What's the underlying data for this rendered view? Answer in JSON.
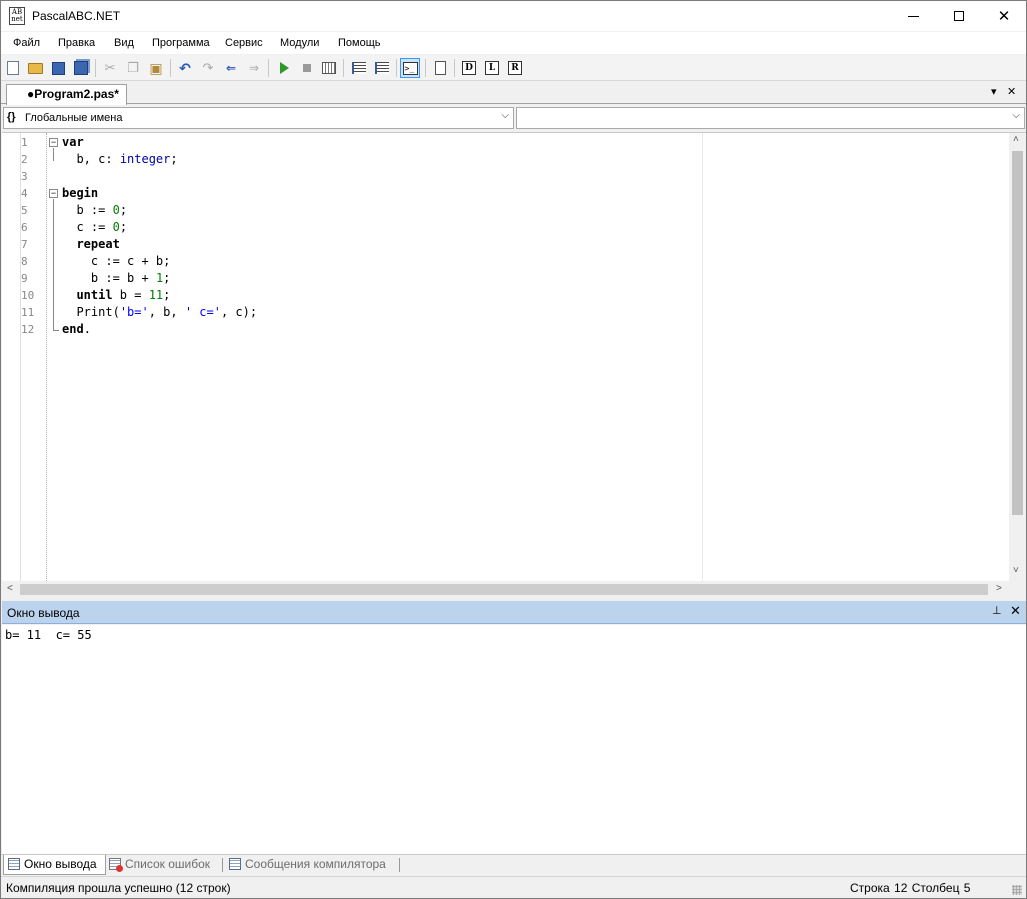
{
  "window": {
    "title": "PascalABC.NET",
    "icon_text": "AB\nnet",
    "minimize_icon": "minimize-icon",
    "maximize_icon": "maximize-icon",
    "close_icon": "close-icon"
  },
  "menu": [
    "Файл",
    "Правка",
    "Вид",
    "Программа",
    "Сервис",
    "Модули",
    "Помощь"
  ],
  "toolbar": {
    "buttons": [
      "new-file",
      "open",
      "save",
      "save-all",
      "cut",
      "copy",
      "paste",
      "undo",
      "redo",
      "find",
      "find-next",
      "run",
      "stop",
      "compile",
      "add-watch",
      "debug-step",
      "console-output",
      "page",
      "d-tool",
      "l-tool",
      "r-tool"
    ],
    "console_glyph": ">_",
    "d_glyph": "D",
    "l_glyph": "L",
    "r_glyph": "R"
  },
  "document_tab": {
    "label": "●Program2.pas*",
    "dropdown_glyph": "▾",
    "close_glyph": "✕"
  },
  "navigation": {
    "left_combo_icon": "{}",
    "left_combo_value": "Глобальные имена",
    "right_combo_value": "",
    "arrow_glyph": "⌵"
  },
  "editor": {
    "line_numbers": [
      "1",
      "2",
      "3",
      "4",
      "5",
      "6",
      "7",
      "8",
      "9",
      "10",
      "11",
      "12"
    ],
    "code_lines": [
      {
        "indent": "",
        "tokens": [
          {
            "t": "var",
            "c": "kw"
          }
        ]
      },
      {
        "indent": "  ",
        "tokens": [
          {
            "t": "b, c: ",
            "c": ""
          },
          {
            "t": "integer",
            "c": "ty"
          },
          {
            "t": ";",
            "c": ""
          }
        ]
      },
      {
        "indent": "",
        "tokens": []
      },
      {
        "indent": "",
        "tokens": [
          {
            "t": "begin",
            "c": "kw"
          }
        ]
      },
      {
        "indent": "  ",
        "tokens": [
          {
            "t": "b := ",
            "c": ""
          },
          {
            "t": "0",
            "c": "num"
          },
          {
            "t": ";",
            "c": ""
          }
        ]
      },
      {
        "indent": "  ",
        "tokens": [
          {
            "t": "c := ",
            "c": ""
          },
          {
            "t": "0",
            "c": "num"
          },
          {
            "t": ";",
            "c": ""
          }
        ]
      },
      {
        "indent": "  ",
        "tokens": [
          {
            "t": "repeat",
            "c": "kw"
          }
        ]
      },
      {
        "indent": "    ",
        "tokens": [
          {
            "t": "c := c + b;",
            "c": ""
          }
        ]
      },
      {
        "indent": "    ",
        "tokens": [
          {
            "t": "b := b + ",
            "c": ""
          },
          {
            "t": "1",
            "c": "num"
          },
          {
            "t": ";",
            "c": ""
          }
        ]
      },
      {
        "indent": "  ",
        "tokens": [
          {
            "t": "until",
            "c": "kw"
          },
          {
            "t": " b = ",
            "c": ""
          },
          {
            "t": "11",
            "c": "num"
          },
          {
            "t": ";",
            "c": ""
          }
        ]
      },
      {
        "indent": "  ",
        "tokens": [
          {
            "t": "Print(",
            "c": ""
          },
          {
            "t": "'b='",
            "c": "str"
          },
          {
            "t": ", b, ",
            "c": ""
          },
          {
            "t": "' c='",
            "c": "str"
          },
          {
            "t": ", c);",
            "c": ""
          }
        ]
      },
      {
        "indent": "",
        "tokens": [
          {
            "t": "end",
            "c": "kw"
          },
          {
            "t": ".",
            "c": ""
          }
        ]
      }
    ],
    "fold_glyph": "−",
    "scroll_up": "˄",
    "scroll_down": "˅",
    "scroll_left": "<",
    "scroll_right": ">"
  },
  "output_panel": {
    "title": "Окно вывода",
    "pin_glyph": "📌",
    "close_glyph": "✕",
    "text": "b= 11  c= 55"
  },
  "bottom_tabs": [
    {
      "label": "Окно вывода",
      "icon": "output-window-icon",
      "active": true
    },
    {
      "label": "Список ошибок",
      "icon": "error-list-icon",
      "active": false
    },
    {
      "label": "Сообщения компилятора",
      "icon": "compiler-messages-icon",
      "active": false
    }
  ],
  "status": {
    "message": "Компиляция прошла успешно (12 строк)",
    "position": "Строка  12  Столбец  5"
  },
  "colors": {
    "output_header": "#bcd3ee",
    "keyword": "#000000",
    "type": "#0000a0",
    "number": "#008000",
    "string": "#0000ff"
  }
}
